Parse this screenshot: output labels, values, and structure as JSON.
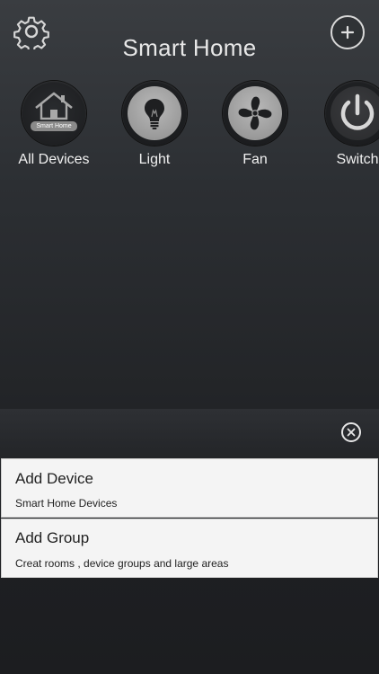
{
  "header": {
    "title": "Smart Home",
    "settings_icon": "gear-icon",
    "add_icon": "plus-icon"
  },
  "categories": [
    {
      "label": "All Devices",
      "icon": "house-icon",
      "badge": "Smart Home"
    },
    {
      "label": "Light",
      "icon": "lightbulb-icon"
    },
    {
      "label": "Fan",
      "icon": "fan-icon"
    },
    {
      "label": "Switch",
      "icon": "power-icon"
    }
  ],
  "add_menu": {
    "close_icon": "close-icon",
    "items": [
      {
        "title": "Add Device",
        "subtitle": "Smart Home Devices"
      },
      {
        "title": "Add Group",
        "subtitle": "Creat rooms , device groups and large areas"
      }
    ]
  },
  "colors": {
    "background_top": "#3a3d41",
    "background_bottom": "#1c1d20",
    "card": "#f4f4f4",
    "icon_grey": "#9e9e9e"
  }
}
